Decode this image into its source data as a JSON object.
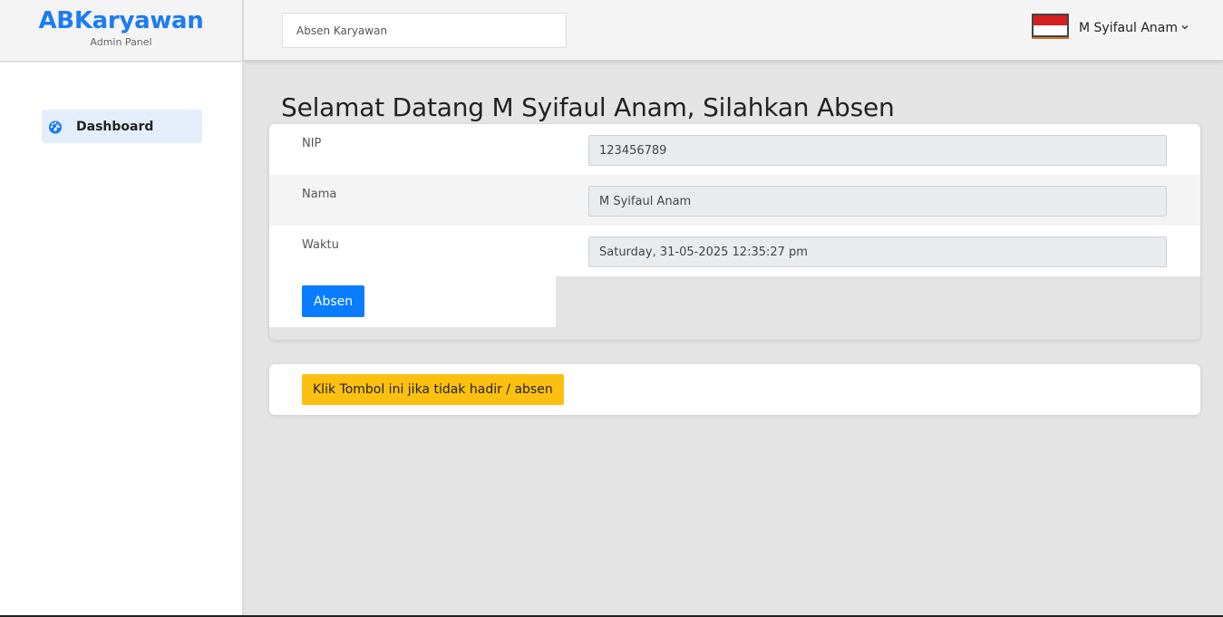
{
  "brand": {
    "title": "ABKaryawan",
    "subtitle": "Admin Panel"
  },
  "topbar": {
    "search_placeholder": "Absen Karyawan",
    "user_name": "M Syifaul Anam",
    "user_flag": "indonesia-flag-icon"
  },
  "sidebar": {
    "items": [
      {
        "label": "Dashboard",
        "icon": "dashboard-gauge-icon",
        "active": true
      }
    ]
  },
  "main": {
    "welcome": "Selamat Datang M Syifaul Anam, Silahkan Absen",
    "form": {
      "nip_label": "NIP",
      "nip_value": "123456789",
      "nama_label": "Nama",
      "nama_value": "M Syifaul Anam",
      "waktu_label": "Waktu",
      "waktu_value": "Saturday, 31-05-2025 12:35:27 pm",
      "submit_label": "Absen"
    },
    "absent_button": "Klik Tombol ini jika tidak hadir / absen"
  },
  "colors": {
    "brand": "#1d7cf2",
    "primary_button": "#0a7cff",
    "warning_button": "#fcc010",
    "sidebar_active": "#e4eefb"
  }
}
